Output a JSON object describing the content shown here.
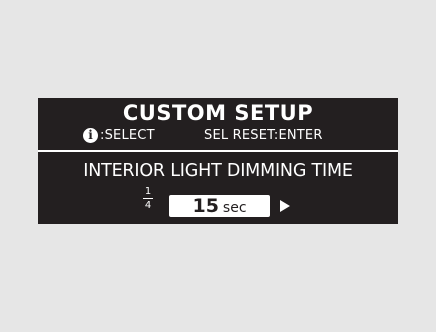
{
  "screen": {
    "title": "CUSTOM SETUP",
    "hints": {
      "info_icon": "info-icon",
      "select_text": ":SELECT",
      "reset_text": "SEL RESET:ENTER"
    },
    "setting": {
      "name": "INTERIOR LIGHT DIMMING TIME",
      "page": {
        "numerator": "1",
        "denominator": "4"
      },
      "value": "15",
      "unit": "sec",
      "next_icon": "right-arrow-icon"
    }
  },
  "colors": {
    "background": "#e6e6e6",
    "panel": "#231f20",
    "text": "#ffffff"
  }
}
